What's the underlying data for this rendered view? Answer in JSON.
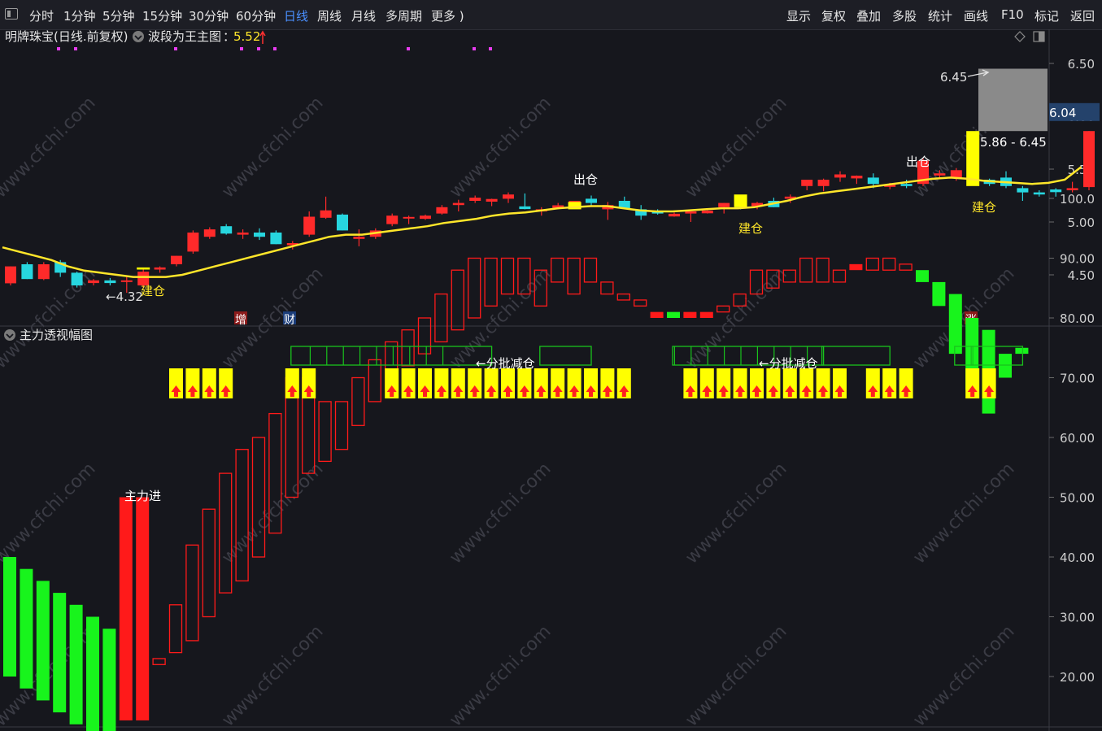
{
  "toolbar": {
    "left_tabs": [
      "分时",
      "1分钟",
      "5分钟",
      "15分钟",
      "30分钟",
      "60分钟",
      "日线",
      "周线",
      "月线",
      "多周期",
      "更多 )"
    ],
    "active_tab": "日线",
    "right_tabs": [
      "显示",
      "复权",
      "叠加",
      "多股",
      "统计",
      "画线",
      "F10",
      "标记",
      "返回"
    ]
  },
  "main_panel": {
    "title": "明牌珠宝(日线.前复权)",
    "indicator_name": "波段为王主图",
    "indicator_value": "5.52",
    "colors": {
      "up": "#ff2a2a",
      "down": "#27d6df",
      "ma": "#ffe62a",
      "signal": "#ffff00",
      "magenta": "#e83cf0"
    }
  },
  "sub_panel": {
    "title": "主力透视幅图",
    "colors": {
      "red": "#ff1a1a",
      "green": "#18f41c",
      "yellow": "#ffff00",
      "box": "#19c21c"
    }
  },
  "chart_data": [
    {
      "type": "candlestick",
      "title": "明牌珠宝(日线.前复权)",
      "y_axis_ticks": [
        "4.50",
        "5.00",
        "5.50",
        "6.00",
        "6.50"
      ],
      "ylim": [
        4.0,
        6.7
      ],
      "price_label": "6.04",
      "annotations": [
        "←4.32",
        "6.45",
        "5.86 - 6.45",
        "出仓",
        "出仓",
        "出仓",
        "建仓",
        "建仓",
        "建仓"
      ],
      "markers": [
        "增",
        "财",
        "涨"
      ],
      "ohlc": [
        [
          4.42,
          4.58,
          4.4,
          4.58
        ],
        [
          4.6,
          4.62,
          4.46,
          4.46
        ],
        [
          4.46,
          4.62,
          4.45,
          4.6
        ],
        [
          4.62,
          4.64,
          4.48,
          4.52
        ],
        [
          4.52,
          4.53,
          4.38,
          4.4
        ],
        [
          4.43,
          4.46,
          4.4,
          4.44
        ],
        [
          4.44,
          4.47,
          4.4,
          4.43
        ],
        [
          4.44,
          4.48,
          4.33,
          4.44
        ],
        [
          4.4,
          4.56,
          4.38,
          4.53
        ],
        [
          4.55,
          4.58,
          4.52,
          4.57
        ],
        [
          4.6,
          4.68,
          4.58,
          4.68
        ],
        [
          4.72,
          4.92,
          4.7,
          4.9
        ],
        [
          4.86,
          4.95,
          4.84,
          4.93
        ],
        [
          4.96,
          4.98,
          4.88,
          4.89
        ],
        [
          4.88,
          4.93,
          4.84,
          4.9
        ],
        [
          4.9,
          4.94,
          4.83,
          4.86
        ],
        [
          4.9,
          4.92,
          4.79,
          4.79
        ],
        [
          4.78,
          4.82,
          4.74,
          4.8
        ],
        [
          4.88,
          5.1,
          4.86,
          5.05
        ],
        [
          5.04,
          5.24,
          5.03,
          5.11
        ],
        [
          5.07,
          5.08,
          4.92,
          4.92
        ],
        [
          4.84,
          4.93,
          4.77,
          4.86
        ],
        [
          4.86,
          4.94,
          4.84,
          4.92
        ],
        [
          4.98,
          5.08,
          4.96,
          5.06
        ],
        [
          5.04,
          5.06,
          4.98,
          5.04
        ],
        [
          5.03,
          5.07,
          5.02,
          5.06
        ],
        [
          5.08,
          5.16,
          5.07,
          5.14
        ],
        [
          5.16,
          5.21,
          5.1,
          5.18
        ],
        [
          5.2,
          5.25,
          5.18,
          5.23
        ],
        [
          5.2,
          5.22,
          5.15,
          5.21
        ],
        [
          5.22,
          5.28,
          5.18,
          5.26
        ],
        [
          5.14,
          5.27,
          5.12,
          5.13
        ],
        [
          5.1,
          5.14,
          5.06,
          5.12
        ],
        [
          5.14,
          5.18,
          5.12,
          5.15
        ],
        [
          5.18,
          5.2,
          5.14,
          5.2
        ],
        [
          5.22,
          5.25,
          5.15,
          5.18
        ],
        [
          5.12,
          5.19,
          5.02,
          5.16
        ],
        [
          5.2,
          5.24,
          5.12,
          5.13
        ],
        [
          5.12,
          5.16,
          5.02,
          5.06
        ],
        [
          5.1,
          5.12,
          5.07,
          5.08
        ],
        [
          5.06,
          5.09,
          5.05,
          5.07
        ],
        [
          5.08,
          5.1,
          5.0,
          5.1
        ],
        [
          5.09,
          5.11,
          5.08,
          5.1
        ],
        [
          5.14,
          5.18,
          5.08,
          5.18
        ],
        [
          5.2,
          5.22,
          5.12,
          5.14
        ],
        [
          5.15,
          5.19,
          5.12,
          5.18
        ],
        [
          5.2,
          5.23,
          5.14,
          5.14
        ],
        [
          5.22,
          5.26,
          5.18,
          5.24
        ],
        [
          5.34,
          5.4,
          5.3,
          5.4
        ],
        [
          5.34,
          5.41,
          5.29,
          5.4
        ],
        [
          5.42,
          5.48,
          5.38,
          5.45
        ],
        [
          5.42,
          5.44,
          5.36,
          5.43
        ],
        [
          5.42,
          5.46,
          5.32,
          5.36
        ],
        [
          5.34,
          5.37,
          5.31,
          5.35
        ],
        [
          5.36,
          5.4,
          5.32,
          5.34
        ],
        [
          5.36,
          5.6,
          5.34,
          5.58
        ],
        [
          5.44,
          5.49,
          5.42,
          5.46
        ],
        [
          5.42,
          5.51,
          5.39,
          5.49
        ],
        [
          5.48,
          5.51,
          5.35,
          5.38
        ],
        [
          5.4,
          5.41,
          5.34,
          5.36
        ],
        [
          5.42,
          5.48,
          5.32,
          5.34
        ],
        [
          5.32,
          5.34,
          5.2,
          5.28
        ],
        [
          5.28,
          5.3,
          5.24,
          5.26
        ],
        [
          5.3,
          5.32,
          5.24,
          5.29
        ],
        [
          5.3,
          5.38,
          5.28,
          5.32
        ],
        [
          5.33,
          5.86,
          5.3,
          5.86
        ]
      ],
      "ma": [
        4.76,
        4.72,
        4.68,
        4.64,
        4.58,
        4.54,
        4.52,
        4.5,
        4.48,
        4.48,
        4.48,
        4.5,
        4.54,
        4.58,
        4.62,
        4.66,
        4.7,
        4.74,
        4.78,
        4.82,
        4.86,
        4.88,
        4.88,
        4.9,
        4.92,
        4.94,
        4.96,
        4.99,
        5.01,
        5.03,
        5.06,
        5.08,
        5.09,
        5.11,
        5.13,
        5.14,
        5.15,
        5.15,
        5.13,
        5.11,
        5.1,
        5.1,
        5.11,
        5.12,
        5.13,
        5.13,
        5.14,
        5.17,
        5.2,
        5.24,
        5.27,
        5.29,
        5.31,
        5.33,
        5.35,
        5.37,
        5.39,
        5.41,
        5.42,
        5.41,
        5.39,
        5.38,
        5.37,
        5.36,
        5.37,
        5.4,
        5.52
      ]
    },
    {
      "type": "bar",
      "title": "主力透视幅图",
      "y_axis_ticks": [
        "20.00",
        "30.00",
        "40.00",
        "50.00",
        "60.00",
        "70.00",
        "80.00",
        "90.00",
        "100.0"
      ],
      "ylim": [
        0,
        105
      ],
      "annotations": [
        "主力进",
        "←分批减仓",
        "←分批减仓"
      ],
      "bars": [
        [
          40,
          20,
          "green",
          "solid"
        ],
        [
          38,
          18,
          "green",
          "solid"
        ],
        [
          36,
          16,
          "green",
          "solid"
        ],
        [
          34,
          14,
          "green",
          "solid"
        ],
        [
          32,
          12,
          "green",
          "solid"
        ],
        [
          30,
          10,
          "green",
          "solid"
        ],
        [
          28,
          8,
          "green",
          "solid"
        ],
        [
          50,
          0,
          "red",
          "solid"
        ],
        [
          50,
          0,
          "red",
          "solid"
        ],
        [
          23,
          22,
          "red",
          "hollow"
        ],
        [
          32,
          24,
          "red",
          "hollow"
        ],
        [
          42,
          26,
          "red",
          "hollow"
        ],
        [
          48,
          30,
          "red",
          "hollow"
        ],
        [
          54,
          34,
          "red",
          "hollow"
        ],
        [
          58,
          36,
          "red",
          "hollow"
        ],
        [
          60,
          40,
          "red",
          "hollow"
        ],
        [
          64,
          44,
          "red",
          "hollow"
        ],
        [
          70,
          50,
          "red",
          "hollow"
        ],
        [
          70,
          54,
          "red",
          "hollow"
        ],
        [
          66,
          56,
          "red",
          "hollow"
        ],
        [
          66,
          58,
          "red",
          "hollow"
        ],
        [
          70,
          62,
          "red",
          "hollow"
        ],
        [
          73,
          66,
          "red",
          "hollow"
        ],
        [
          76,
          68,
          "red",
          "hollow"
        ],
        [
          78,
          72,
          "red",
          "hollow"
        ],
        [
          80,
          74,
          "red",
          "hollow"
        ],
        [
          84,
          76,
          "red",
          "hollow"
        ],
        [
          88,
          78,
          "red",
          "hollow"
        ],
        [
          90,
          80,
          "red",
          "hollow"
        ],
        [
          90,
          82,
          "red",
          "hollow"
        ],
        [
          90,
          84,
          "red",
          "hollow"
        ],
        [
          90,
          84,
          "red",
          "hollow"
        ],
        [
          88,
          82,
          "red",
          "hollow"
        ],
        [
          90,
          86,
          "red",
          "hollow"
        ],
        [
          90,
          84,
          "red",
          "hollow"
        ],
        [
          90,
          86,
          "red",
          "hollow"
        ],
        [
          86,
          84,
          "red",
          "hollow"
        ],
        [
          84,
          83,
          "red",
          "hollow"
        ],
        [
          83,
          82,
          "red",
          "hollow"
        ],
        [
          81,
          80,
          "red",
          "solid"
        ],
        [
          81,
          80,
          "green",
          "solid"
        ],
        [
          81,
          80,
          "red",
          "solid"
        ],
        [
          81,
          80,
          "red",
          "solid"
        ],
        [
          82,
          81,
          "red",
          "hollow"
        ],
        [
          84,
          82,
          "red",
          "hollow"
        ],
        [
          88,
          84,
          "red",
          "hollow"
        ],
        [
          88,
          85,
          "red",
          "hollow"
        ],
        [
          88,
          86,
          "red",
          "hollow"
        ],
        [
          90,
          86,
          "red",
          "hollow"
        ],
        [
          90,
          86,
          "red",
          "hollow"
        ],
        [
          88,
          86,
          "red",
          "hollow"
        ],
        [
          89,
          88,
          "red",
          "solid"
        ],
        [
          90,
          88,
          "red",
          "hollow"
        ],
        [
          90,
          88,
          "red",
          "hollow"
        ],
        [
          89,
          88,
          "red",
          "hollow"
        ],
        [
          88,
          86,
          "green",
          "solid"
        ],
        [
          86,
          82,
          "green",
          "solid"
        ],
        [
          84,
          74,
          "green",
          "solid"
        ],
        [
          80,
          68,
          "green",
          "solid"
        ],
        [
          78,
          64,
          "green",
          "solid"
        ],
        [
          74,
          70,
          "green",
          "solid"
        ],
        [
          75,
          74,
          "green",
          "solid"
        ]
      ],
      "signal_arrows": [
        10,
        11,
        12,
        13,
        17,
        18,
        23,
        24,
        25,
        26,
        27,
        28,
        29,
        30,
        31,
        32,
        33,
        34,
        35,
        36,
        37,
        41,
        42,
        43,
        44,
        45,
        46,
        47,
        48,
        49,
        50,
        52,
        53,
        54,
        58,
        59
      ],
      "green_boxes": [
        [
          17,
          29
        ],
        [
          32,
          35
        ],
        [
          40,
          49
        ],
        [
          49,
          53
        ],
        [
          57,
          58
        ],
        [
          58,
          61
        ]
      ]
    }
  ]
}
